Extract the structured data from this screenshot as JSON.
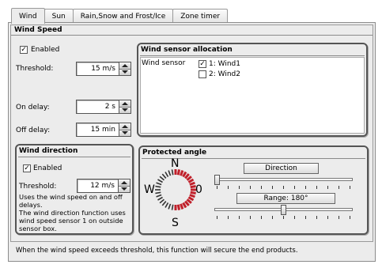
{
  "tabs": [
    {
      "label": "Wind",
      "active": true
    },
    {
      "label": "Sun",
      "active": false
    },
    {
      "label": "Rain,Snow and Frost/Ice",
      "active": false
    },
    {
      "label": "Zone timer",
      "active": false
    }
  ],
  "wind_speed": {
    "title": "Wind Speed",
    "enabled_label": "Enabled",
    "enabled": true,
    "threshold_label": "Threshold:",
    "threshold_value": "15 m/s",
    "on_delay_label": "On delay:",
    "on_delay_value": "2 s",
    "off_delay_label": "Off delay:",
    "off_delay_value": "15 min"
  },
  "sensor_allocation": {
    "title": "Wind sensor allocation",
    "row_label": "Wind sensor",
    "sensors": [
      {
        "label": "1: Wind1",
        "checked": true
      },
      {
        "label": "2: Wind2",
        "checked": false
      }
    ]
  },
  "wind_direction": {
    "title": "Wind direction",
    "enabled_label": "Enabled",
    "enabled": true,
    "threshold_label": "Threshold:",
    "threshold_value": "12 m/s",
    "description": "Uses the wind speed on and off delays.\nThe wind direction function uses wind speed sensor 1 on outside sensor box."
  },
  "protected_angle": {
    "title": "Protected angle",
    "compass": {
      "n": "N",
      "s": "S",
      "w": "W",
      "center": "0"
    },
    "direction_button": "Direction",
    "direction_value": 0,
    "range_button": "Range:  180°",
    "range_degrees": 180,
    "accent_color": "#c0202a"
  },
  "footer_text": "When the wind speed exceeds threshold, this function will secure the end products."
}
